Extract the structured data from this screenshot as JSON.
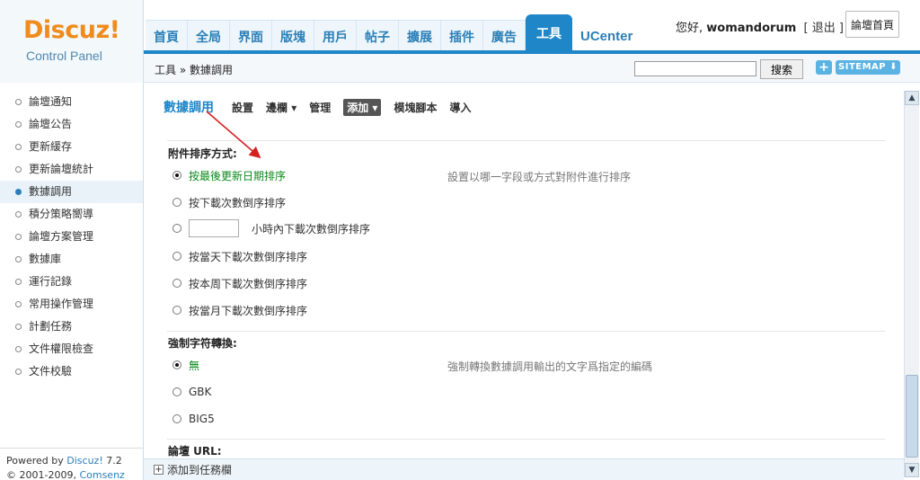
{
  "logo": {
    "brand": "Discuz!",
    "subtitle": "Control Panel"
  },
  "nav": {
    "tabs": [
      "首頁",
      "全局",
      "界面",
      "版塊",
      "用戶",
      "帖子",
      "擴展",
      "插件",
      "廣告",
      "工具",
      "UCenter"
    ],
    "active": "工具"
  },
  "user": {
    "greeting": "您好,",
    "name": "womandorum",
    "logout": "[ 退出 ]",
    "home_button": "論壇首頁"
  },
  "breadcrumb": "工具 » 數據調用",
  "search": {
    "value": "",
    "button": "搜索"
  },
  "sitemap": {
    "plus": "+",
    "label": "SITEMAP ⬇"
  },
  "sidebar": {
    "items": [
      "論壇通知",
      "論壇公告",
      "更新緩存",
      "更新論壇統計",
      "數據調用",
      "積分策略嚮導",
      "論壇方案管理",
      "數據庫",
      "運行記錄",
      "常用操作管理",
      "計劃任務",
      "文件權限檢查",
      "文件校驗"
    ],
    "active": "數據調用"
  },
  "footer": {
    "powered": "Powered by",
    "brand": "Discuz!",
    "version": "7.2",
    "copyright": "© 2001-2009,",
    "company": "Comsenz Inc."
  },
  "subnav": {
    "title": "數據調用",
    "items": [
      "設置",
      "邊欄 ▾",
      "管理",
      "添加 ▾",
      "模塊腳本",
      "導入"
    ]
  },
  "sections": {
    "attach_sort": {
      "title": "附件排序方式:",
      "hint": "設置以哪一字段或方式對附件進行排序",
      "options": [
        "按最後更新日期排序",
        "按下載次數倒序排序",
        "小時內下載次數倒序排序",
        "按當天下載次數倒序排序",
        "按本周下載次數倒序排序",
        "按當月下載次數倒序排序"
      ]
    },
    "charset": {
      "title": "強制字符轉換:",
      "hint": "強制轉換數據調用輸出的文字爲指定的編碼",
      "options": [
        "無",
        "GBK",
        "BIG5"
      ]
    },
    "url": {
      "title": "論壇 URL:"
    }
  },
  "bottombar": {
    "add_task": "添加到任務欄",
    "add_icon": "+"
  },
  "colors": {
    "accent": "#1f86c8",
    "logo_orange": "#f08b1c",
    "selected_green": "#0a8a1a",
    "arrow_red": "#d42020"
  }
}
